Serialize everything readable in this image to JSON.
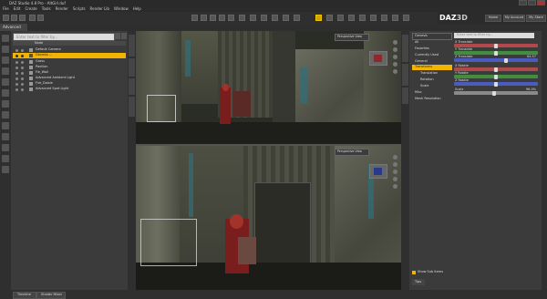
{
  "window": {
    "title": "DAZ Studio 4.8 Pro - AltGirl.duf",
    "controls": [
      "minimize-icon",
      "maximize-icon",
      "close-icon"
    ]
  },
  "menu": [
    "File",
    "Edit",
    "Create",
    "Tools",
    "Render",
    "Scripts",
    "Render Lib",
    "Window",
    "Help"
  ],
  "brand": {
    "logo_text": "DAZ",
    "logo_3d": "3D",
    "buttons": [
      "Home",
      "My Account",
      "My Store"
    ]
  },
  "layout_tab": "Advanced",
  "scene": {
    "search_placeholder": "Enter text to filter by...",
    "header_label": "Node",
    "rows": [
      {
        "label": "Default Camera",
        "selected": false
      },
      {
        "label": "Genesis ...",
        "selected": true
      },
      {
        "label": "Grass",
        "selected": false
      },
      {
        "label": "Pavilion",
        "selected": false
      },
      {
        "label": "Fie_Wall",
        "selected": false
      },
      {
        "label": "Advanced Ambient Light",
        "selected": false
      },
      {
        "label": "Fire_Daisie",
        "selected": false
      },
      {
        "label": "Advanced Spot Light",
        "selected": false
      }
    ]
  },
  "viewports": {
    "top_camera": "Perspective View",
    "bottom_camera": "Perspective View"
  },
  "parameters": {
    "selector": "Genesis",
    "search_placeholder": "Enter text to filter by...",
    "tree": [
      {
        "label": "All",
        "selected": false
      },
      {
        "label": "Favorites",
        "selected": false
      },
      {
        "label": "Currently Used",
        "selected": false
      },
      {
        "label": "General",
        "selected": false
      },
      {
        "label": "Transforms",
        "selected": true
      },
      {
        "label": "Translation",
        "selected": false
      },
      {
        "label": "Rotation",
        "selected": false
      },
      {
        "label": "Scale",
        "selected": false
      },
      {
        "label": "Misc",
        "selected": false
      },
      {
        "label": "Mesh Resolution",
        "selected": false
      }
    ],
    "sliders": [
      {
        "label": "X Translate",
        "value": "",
        "color": "#b04a4a",
        "level": 0.5
      },
      {
        "label": "Y Translate",
        "value": "",
        "color": "#3f8f3f",
        "level": 0.5
      },
      {
        "label": "Z Translate",
        "value": "64.57",
        "color": "#4a5cbf",
        "level": 0.62
      },
      {
        "label": "X Rotate",
        "value": "",
        "color": "#b04a4a",
        "level": 0.5
      },
      {
        "label": "Y Rotate",
        "value": "",
        "color": "#3f8f3f",
        "level": 0.5
      },
      {
        "label": "Z Rotate",
        "value": "",
        "color": "#4a5cbf",
        "level": 0.5
      },
      {
        "label": "Scale",
        "value": "96.0%",
        "color": "#8a8a8a",
        "level": 0.48
      }
    ],
    "show_sub_items": "Show Sub Items",
    "tips_tab": "Tips"
  },
  "bottom_tabs": [
    "Timeline",
    "Shader Mixer"
  ],
  "colors": {
    "accent": "#f2b400",
    "panel": "#3b3b3b",
    "dark": "#2f2f2f"
  }
}
